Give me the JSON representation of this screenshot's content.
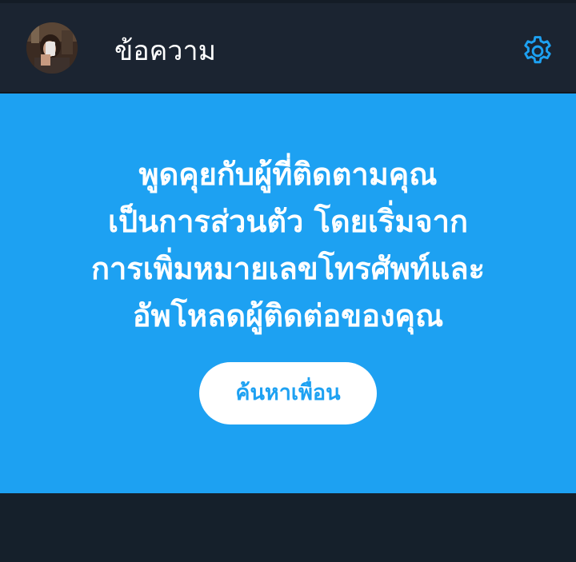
{
  "header": {
    "title": "ข้อความ",
    "avatar_icon": "user-avatar",
    "settings_icon": "gear-icon"
  },
  "promo": {
    "lines": [
      "พูดคุยกับผู้ที่ติดตามคุณ",
      "เป็นการส่วนตัว โดยเริ่มจาก",
      "การเพิ่มหมายเลขโทรศัพท์และ",
      "อัพโหลดผู้ติดต่อของคุณ"
    ],
    "button_label": "ค้นหาเพื่อน"
  },
  "colors": {
    "header_bg": "#1b2431",
    "accent": "#1da1f2",
    "page_bg": "#15202b",
    "text": "#ffffff"
  }
}
